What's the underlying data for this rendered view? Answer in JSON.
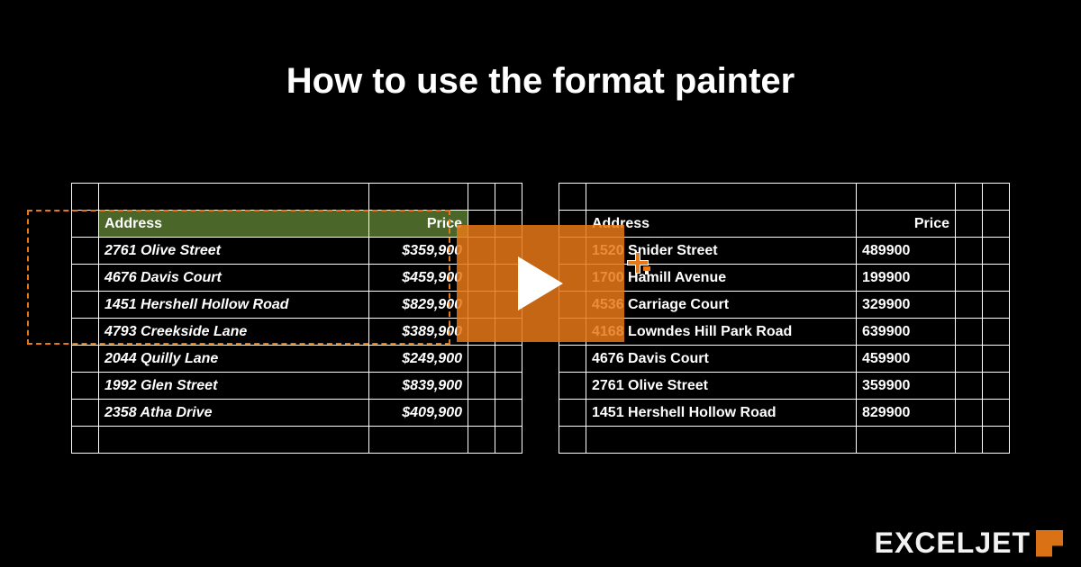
{
  "title": "How to use the format painter",
  "left_table": {
    "headers": {
      "address": "Address",
      "price": "Price"
    },
    "rows": [
      {
        "address": "2761 Olive Street",
        "price": "$359,900"
      },
      {
        "address": "4676 Davis Court",
        "price": "$459,900"
      },
      {
        "address": "1451 Hershell Hollow Road",
        "price": "$829,900"
      },
      {
        "address": "4793 Creekside Lane",
        "price": "$389,900"
      },
      {
        "address": "2044 Quilly Lane",
        "price": "$249,900"
      },
      {
        "address": "1992 Glen Street",
        "price": "$839,900"
      },
      {
        "address": "2358 Atha Drive",
        "price": "$409,900"
      }
    ]
  },
  "right_table": {
    "headers": {
      "address": "Address",
      "price": "Price"
    },
    "rows": [
      {
        "address": "1520 Snider Street",
        "price": "489900"
      },
      {
        "address": "1700 Hamill Avenue",
        "price": "199900"
      },
      {
        "address": "4536 Carriage Court",
        "price": "329900"
      },
      {
        "address": "4168 Lowndes Hill Park Road",
        "price": "639900"
      },
      {
        "address": "4676 Davis Court",
        "price": "459900"
      },
      {
        "address": "2761 Olive Street",
        "price": "359900"
      },
      {
        "address": "1451 Hershell Hollow Road",
        "price": "829900"
      }
    ]
  },
  "logo": "EXCELJET",
  "colors": {
    "accent": "#e67817",
    "header_bg": "#4a6628"
  }
}
